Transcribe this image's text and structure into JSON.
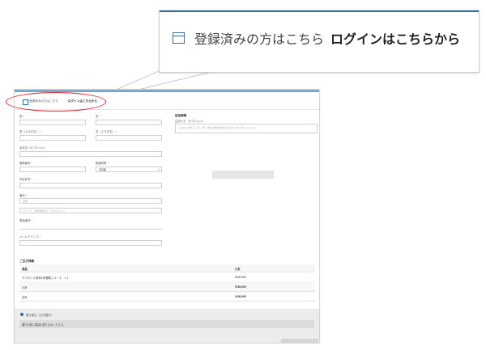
{
  "zoom": {
    "registered_text": "登録済みの方はこちら",
    "login_link": "ログインはこちらから"
  },
  "notice": {
    "registered_text": "登録済みの方はこちら",
    "login_link": "ログインはこちらから"
  },
  "form": {
    "last_name_label": "姓",
    "first_name_label": "名",
    "last_kana_label": "姓（ふりがな）",
    "first_kana_label": "名（ふりがな）",
    "company_label": "会社名（オプション）",
    "postal_label": "郵便番号",
    "prefecture_label": "都道府県",
    "prefecture_value": "東京都",
    "city_label": "市区町村",
    "address_label": "番地",
    "address_placeholder": "番地",
    "address2_placeholder": "アパート、部屋番号など（オプション）",
    "phone_label": "電話番号",
    "email_label": "メールアドレス",
    "required_mark": "*"
  },
  "additional": {
    "title": "追加情報",
    "notes_label": "注文メモ（オプション）",
    "notes_placeholder": "ご注文に関するメモ、例：配達の際の特別な指示などをご記入ください。"
  },
  "order": {
    "title": "ご注文詳細",
    "col_product": "商品",
    "col_subtotal": "小計",
    "rows": [
      {
        "name": "ライセンス商材1年間購入コース　× 1",
        "value": "¥180,000"
      },
      {
        "name": "小計",
        "value": "¥180,000"
      },
      {
        "name": "合計",
        "value": "¥180,000"
      }
    ]
  },
  "payment": {
    "method_label": "銀行振込（日本国内）",
    "description": "銀行口座に直接お振り込みください。"
  },
  "colors": {
    "accent": "#2a6fb0",
    "highlight_circle": "#d9262c"
  }
}
